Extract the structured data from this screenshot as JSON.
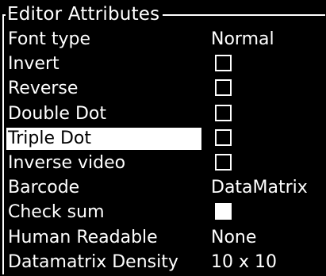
{
  "panel": {
    "title": "Editor Attributes"
  },
  "rows": [
    {
      "label": "Font type",
      "kind": "value",
      "value": "Normal"
    },
    {
      "label": "Invert",
      "kind": "checkbox",
      "checked": false
    },
    {
      "label": "Reverse",
      "kind": "checkbox",
      "checked": false
    },
    {
      "label": "Double Dot",
      "kind": "checkbox",
      "checked": false
    },
    {
      "label": "Triple Dot",
      "kind": "checkbox",
      "checked": false,
      "selected": true
    },
    {
      "label": "Inverse video",
      "kind": "checkbox",
      "checked": false
    },
    {
      "label": "Barcode",
      "kind": "value",
      "value": "DataMatrix"
    },
    {
      "label": "Check sum",
      "kind": "checkbox",
      "checked": true
    },
    {
      "label": "Human Readable",
      "kind": "value",
      "value": "None"
    },
    {
      "label": "Datamatrix Density",
      "kind": "value",
      "value": "10 x 10"
    }
  ],
  "colors": {
    "background": "#000000",
    "foreground": "#ffffff"
  }
}
